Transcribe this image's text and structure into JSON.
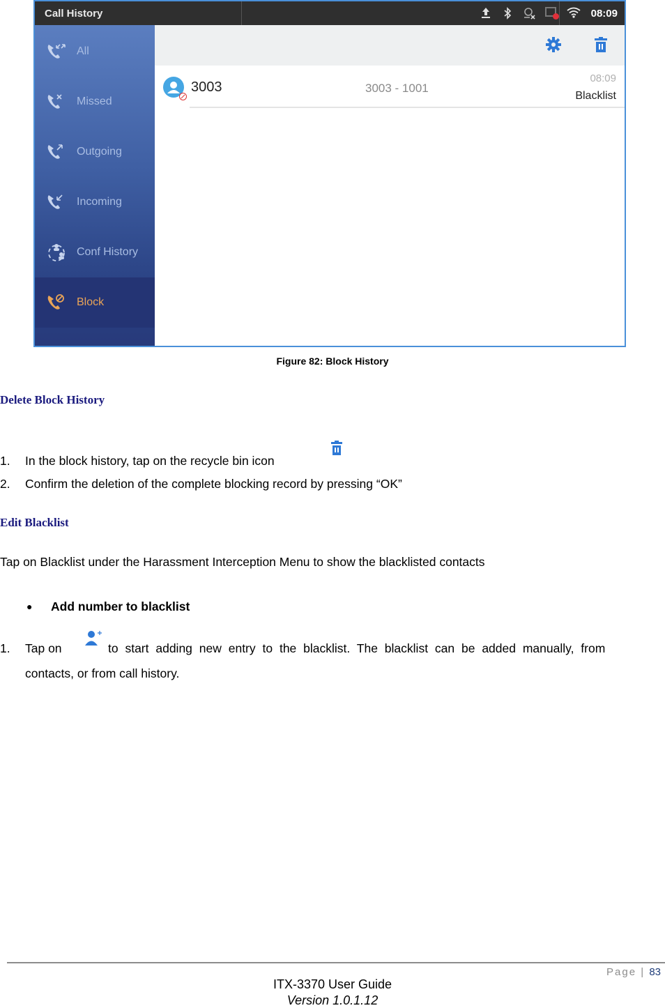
{
  "screenshot": {
    "app_title": "Call History",
    "status_bar": {
      "icons": [
        "upload-icon",
        "bluetooth-icon",
        "missed-call-notice-icon",
        "recording-icon",
        "wifi-icon"
      ],
      "time": "08:09"
    },
    "sidebar": {
      "items": [
        {
          "label": "All",
          "icon": "all-calls-icon",
          "active": false
        },
        {
          "label": "Missed",
          "icon": "missed-call-icon",
          "active": false
        },
        {
          "label": "Outgoing",
          "icon": "outgoing-call-icon",
          "active": false
        },
        {
          "label": "Incoming",
          "icon": "incoming-call-icon",
          "active": false
        },
        {
          "label": "Conf History",
          "icon": "conference-icon",
          "active": false
        },
        {
          "label": "Block",
          "icon": "block-call-icon",
          "active": true
        }
      ]
    },
    "toolbar": {
      "settings_icon": "gear-icon",
      "delete_icon": "trash-icon"
    },
    "records": [
      {
        "name": "3003",
        "detail": "3003 - 1001",
        "time": "08:09",
        "status": "Blacklist"
      }
    ],
    "colors": {
      "accent": "#2e79d6",
      "active_label": "#e9a457",
      "status_bar": "#2f2f2f",
      "sidebar_top": "#5b7ec0",
      "sidebar_bottom": "#27397a"
    }
  },
  "caption": "Figure 82: Block History",
  "sections": {
    "delete_heading": "Delete Block History",
    "delete_steps": [
      {
        "num": "1.",
        "text": "In the block history, tap on the recycle bin icon"
      },
      {
        "num": "2.",
        "text": "Confirm the deletion of the complete blocking record by pressing “OK”"
      }
    ],
    "edit_heading": "Edit Blacklist",
    "edit_intro": "Tap on Blacklist under the Harassment Interception Menu to show the blacklisted contacts",
    "bullet_label": "Add number to blacklist",
    "add_step": {
      "num": "1.",
      "text_before": "Tap on",
      "text_after": "to start adding new entry to the blacklist. The blacklist can be added manually, from",
      "text_line2": "contacts, or from call history."
    }
  },
  "footer": {
    "page_label": "Page",
    "page_number": "83",
    "title": "ITX-3370 User Guide",
    "version": "Version 1.0.1.12"
  }
}
